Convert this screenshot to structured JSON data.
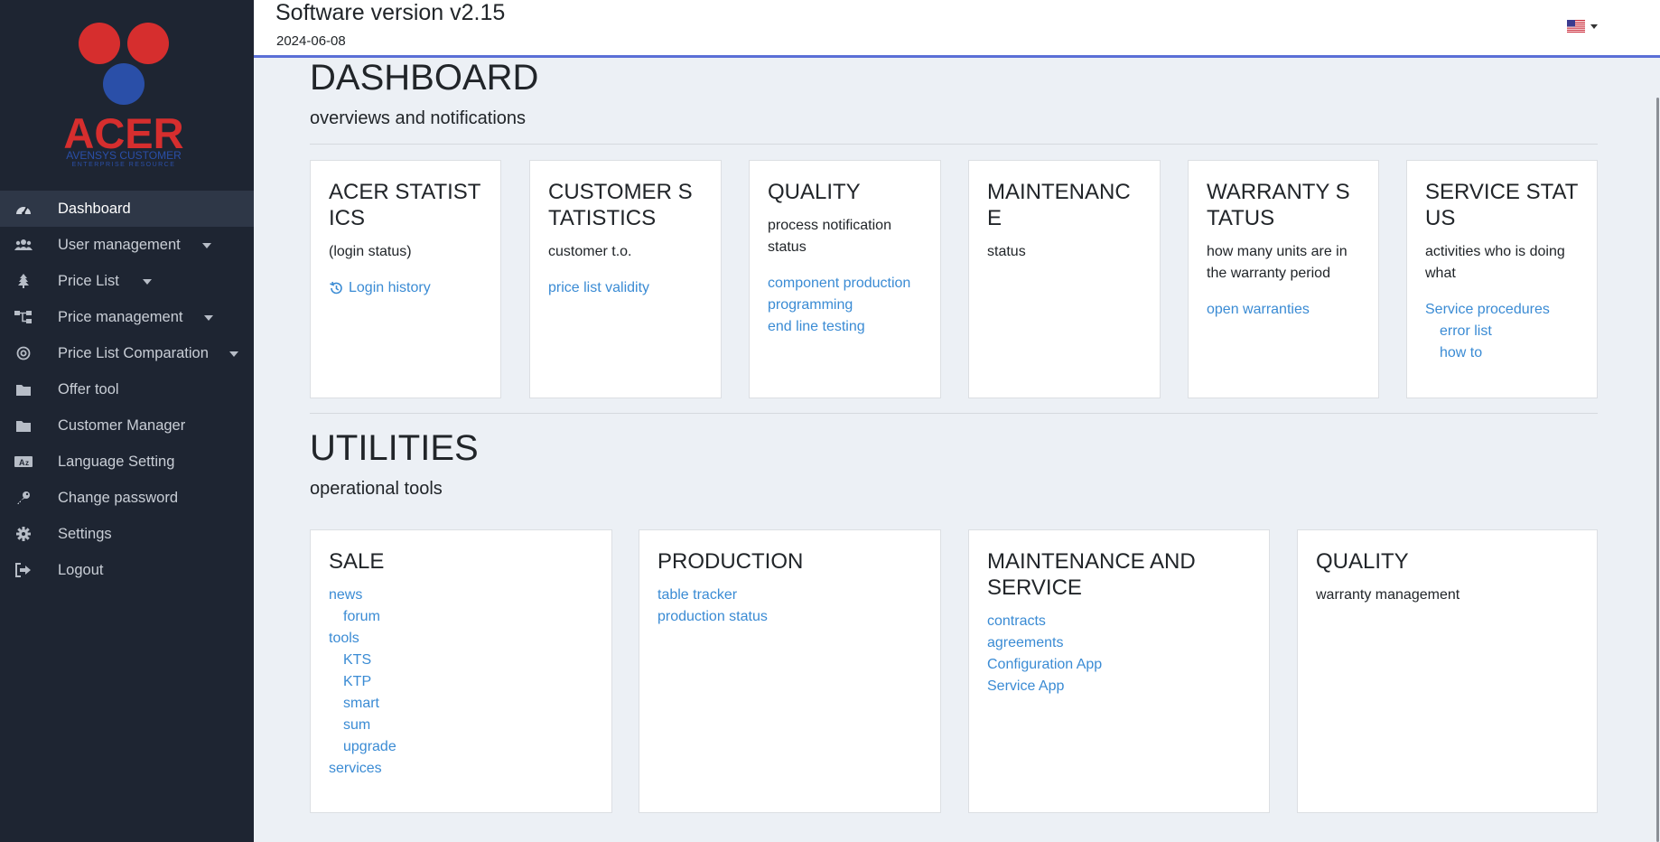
{
  "app": {
    "title": "Software version v2.15",
    "date": "2024-06-08"
  },
  "brand": {
    "name": "ACER",
    "tagline_1": "AVENSYS CUSTOMER",
    "tagline_2": "ENTERPRISE RESOURCE",
    "colors": {
      "red": "#d62e2e",
      "blue": "#2a4fa8"
    }
  },
  "sidebar": {
    "items": [
      {
        "label": "Dashboard",
        "icon": "gauge-icon",
        "active": true
      },
      {
        "label": "User management",
        "icon": "users-icon",
        "dropdown": true
      },
      {
        "label": "Price List",
        "icon": "tree-icon",
        "dropdown": true
      },
      {
        "label": "Price management",
        "icon": "sitemap-icon",
        "dropdown": true
      },
      {
        "label": "Price List Comparation",
        "icon": "bullseye-icon",
        "dropdown": true
      },
      {
        "label": "Offer tool",
        "icon": "folder-icon"
      },
      {
        "label": "Customer Manager",
        "icon": "folder-icon"
      },
      {
        "label": "Language Setting",
        "icon": "language-icon"
      },
      {
        "label": "Change password",
        "icon": "key-icon"
      },
      {
        "label": "Settings",
        "icon": "gear-icon"
      },
      {
        "label": "Logout",
        "icon": "logout-icon"
      }
    ]
  },
  "language": {
    "selected": "us-flag-icon"
  },
  "dashboard": {
    "title": "DASHBOARD",
    "subtitle": "overviews and notifications",
    "cards": [
      {
        "title": "ACER STATISTICS",
        "text": "(login status)",
        "links": [
          "Login history"
        ]
      },
      {
        "title": "CUSTOMER STATISTICS",
        "text": "customer t.o.",
        "links": [
          "price list validity"
        ]
      },
      {
        "title": "QUALITY",
        "text": "process notification status",
        "links": [
          "component production",
          "programming",
          "end line testing"
        ]
      },
      {
        "title": "MAINTENANCE",
        "text": "status",
        "links": []
      },
      {
        "title": "WARRANTY STATUS",
        "text": "how many units are in the warranty period",
        "links": [
          "open warranties"
        ]
      },
      {
        "title": "SERVICE STATUS",
        "text": "activities who is doing what",
        "links": [
          "Service procedures",
          "error list",
          "how to"
        ]
      }
    ]
  },
  "utilities": {
    "title": "UTILITIES",
    "subtitle": "operational tools",
    "cards": [
      {
        "title": "SALE",
        "links": [
          "news",
          "forum",
          "tools",
          "KTS",
          "KTP",
          "smart",
          "sum",
          "upgrade",
          "services"
        ]
      },
      {
        "title": "PRODUCTION",
        "links": [
          "table tracker",
          "production status"
        ]
      },
      {
        "title": "MAINTENANCE AND SERVICE",
        "links": [
          "contracts",
          "agreements",
          "Configuration App",
          "Service App"
        ]
      },
      {
        "title": "QUALITY",
        "text": "warranty management"
      }
    ]
  }
}
